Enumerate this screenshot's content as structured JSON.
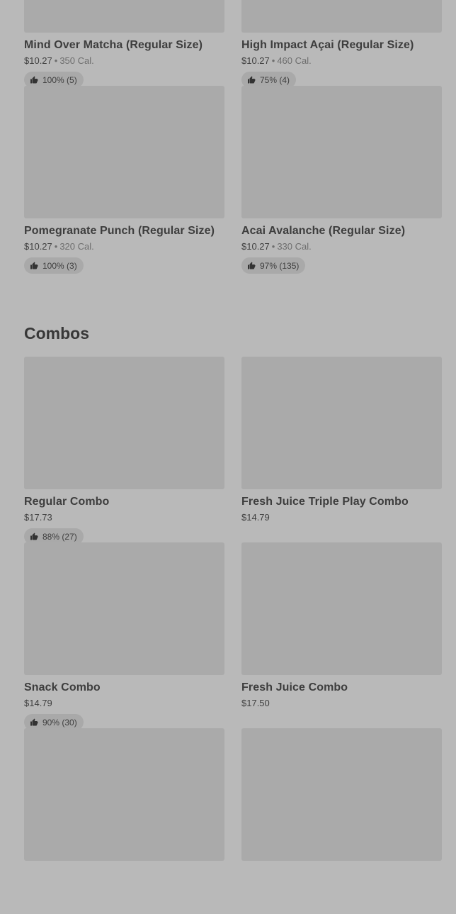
{
  "smoothies": [
    {
      "title": "Mind Over Matcha (Regular Size)",
      "price": "$10.27",
      "calories": "350 Cal.",
      "rating": "100% (5)"
    },
    {
      "title": "High Impact Açai (Regular Size)",
      "price": "$10.27",
      "calories": "460 Cal.",
      "rating": "75% (4)"
    },
    {
      "title": "Pomegranate Punch (Regular Size)",
      "price": "$10.27",
      "calories": "320 Cal.",
      "rating": "100% (3)"
    },
    {
      "title": "Acai Avalanche (Regular Size)",
      "price": "$10.27",
      "calories": "330 Cal.",
      "rating": "97% (135)"
    }
  ],
  "combos_section": {
    "title": "Combos"
  },
  "combos": [
    {
      "title": "Regular Combo",
      "price": "$17.73",
      "rating": "88% (27)"
    },
    {
      "title": "Fresh Juice Triple Play Combo",
      "price": "$14.79"
    },
    {
      "title": "Snack Combo",
      "price": "$14.79",
      "rating": "90% (30)"
    },
    {
      "title": "Fresh Juice Combo",
      "price": "$17.50"
    },
    {
      "title": ""
    },
    {
      "title": ""
    }
  ],
  "separator": "•",
  "icons": {
    "rating": "thumbs-up-icon"
  },
  "colors": {
    "background": "#b9b9b9",
    "image_placeholder": "#aaaaaa",
    "badge": "#a9a9a9"
  }
}
